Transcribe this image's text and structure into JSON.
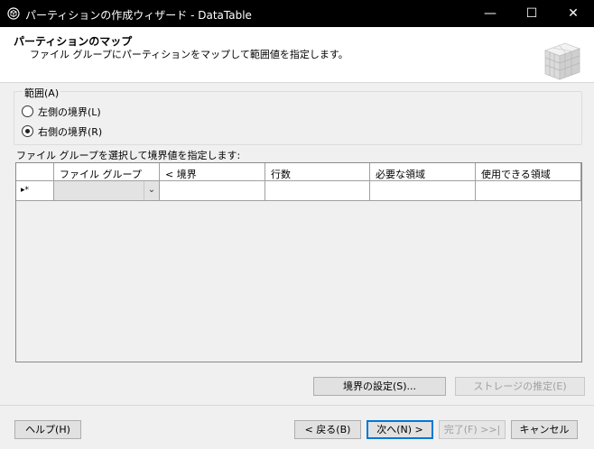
{
  "window": {
    "title": "パーティションの作成ウィザード - DataTable",
    "minimize": "—",
    "maximize": "☐",
    "close": "✕"
  },
  "header": {
    "title": "パーティションのマップ",
    "subtitle": "ファイル グループにパーティションをマップして範囲値を指定します。"
  },
  "range_group": {
    "label": "範囲(A)",
    "options": [
      {
        "label": "左側の境界(L)",
        "selected": false
      },
      {
        "label": "右側の境界(R)",
        "selected": true
      }
    ]
  },
  "grid": {
    "caption": "ファイル グループを選択して境界値を指定します:",
    "columns": [
      "",
      "ファイル グループ",
      "< 境界",
      "行数",
      "必要な領域",
      "使用できる領域"
    ],
    "new_row_indicator": "▸*"
  },
  "buttons": {
    "set_boundaries": "境界の設定(S)...",
    "estimate_storage": "ストレージの推定(E)",
    "help": "ヘルプ(H)",
    "back": "< 戻る(B)",
    "next": "次へ(N) >",
    "finish": "完了(F) >>|",
    "cancel": "キャンセル"
  }
}
